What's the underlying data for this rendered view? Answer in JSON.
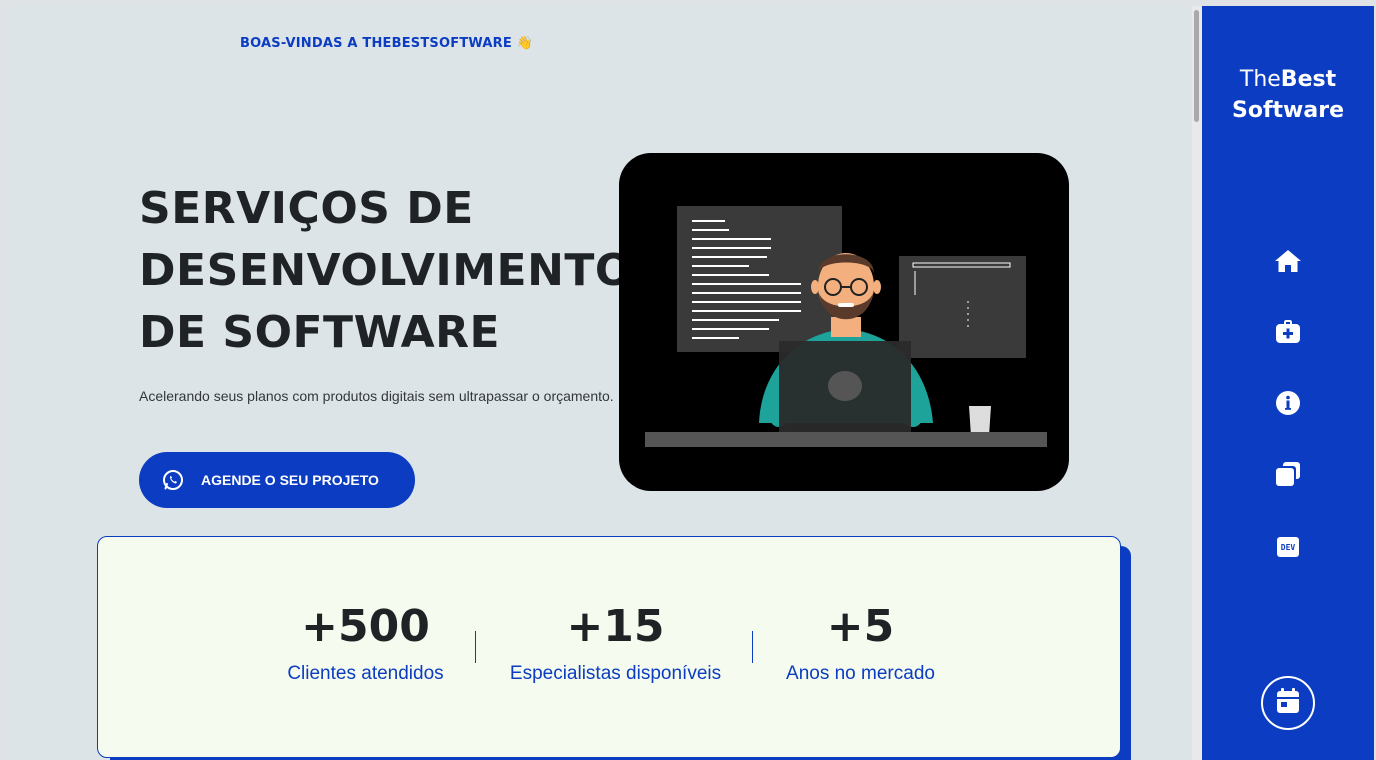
{
  "header": {
    "welcome": "BOAS-VINDAS A THEBESTSOFTWARE 👋"
  },
  "hero": {
    "title": "SERVIÇOS DE DESENVOLVIMENTO DE SOFTWARE",
    "subtitle": "Acelerando seus planos com produtos digitais sem ultrapassar o orçamento.",
    "cta_label": "AGENDE O SEU PROJETO",
    "cta_icon": "whatsapp-icon"
  },
  "stats": [
    {
      "value": "+500",
      "label": "Clientes atendidos"
    },
    {
      "value": "+15",
      "label": "Especialistas disponíveis"
    },
    {
      "value": "+5",
      "label": "Anos no mercado"
    }
  ],
  "sidebar": {
    "brand_light": "The",
    "brand_bold_1": "Best",
    "brand_bold_2": "Software",
    "nav_icons": [
      "home-icon",
      "medkit-icon",
      "info-icon",
      "copy-icon",
      "dev-icon"
    ],
    "dev_badge": "DEV",
    "calendar_icon": "calendar-icon"
  },
  "colors": {
    "accent": "#0b3cc1",
    "page_bg": "#dce4e8",
    "stats_bg": "#f5fcef",
    "text_dark": "#1f2326"
  }
}
